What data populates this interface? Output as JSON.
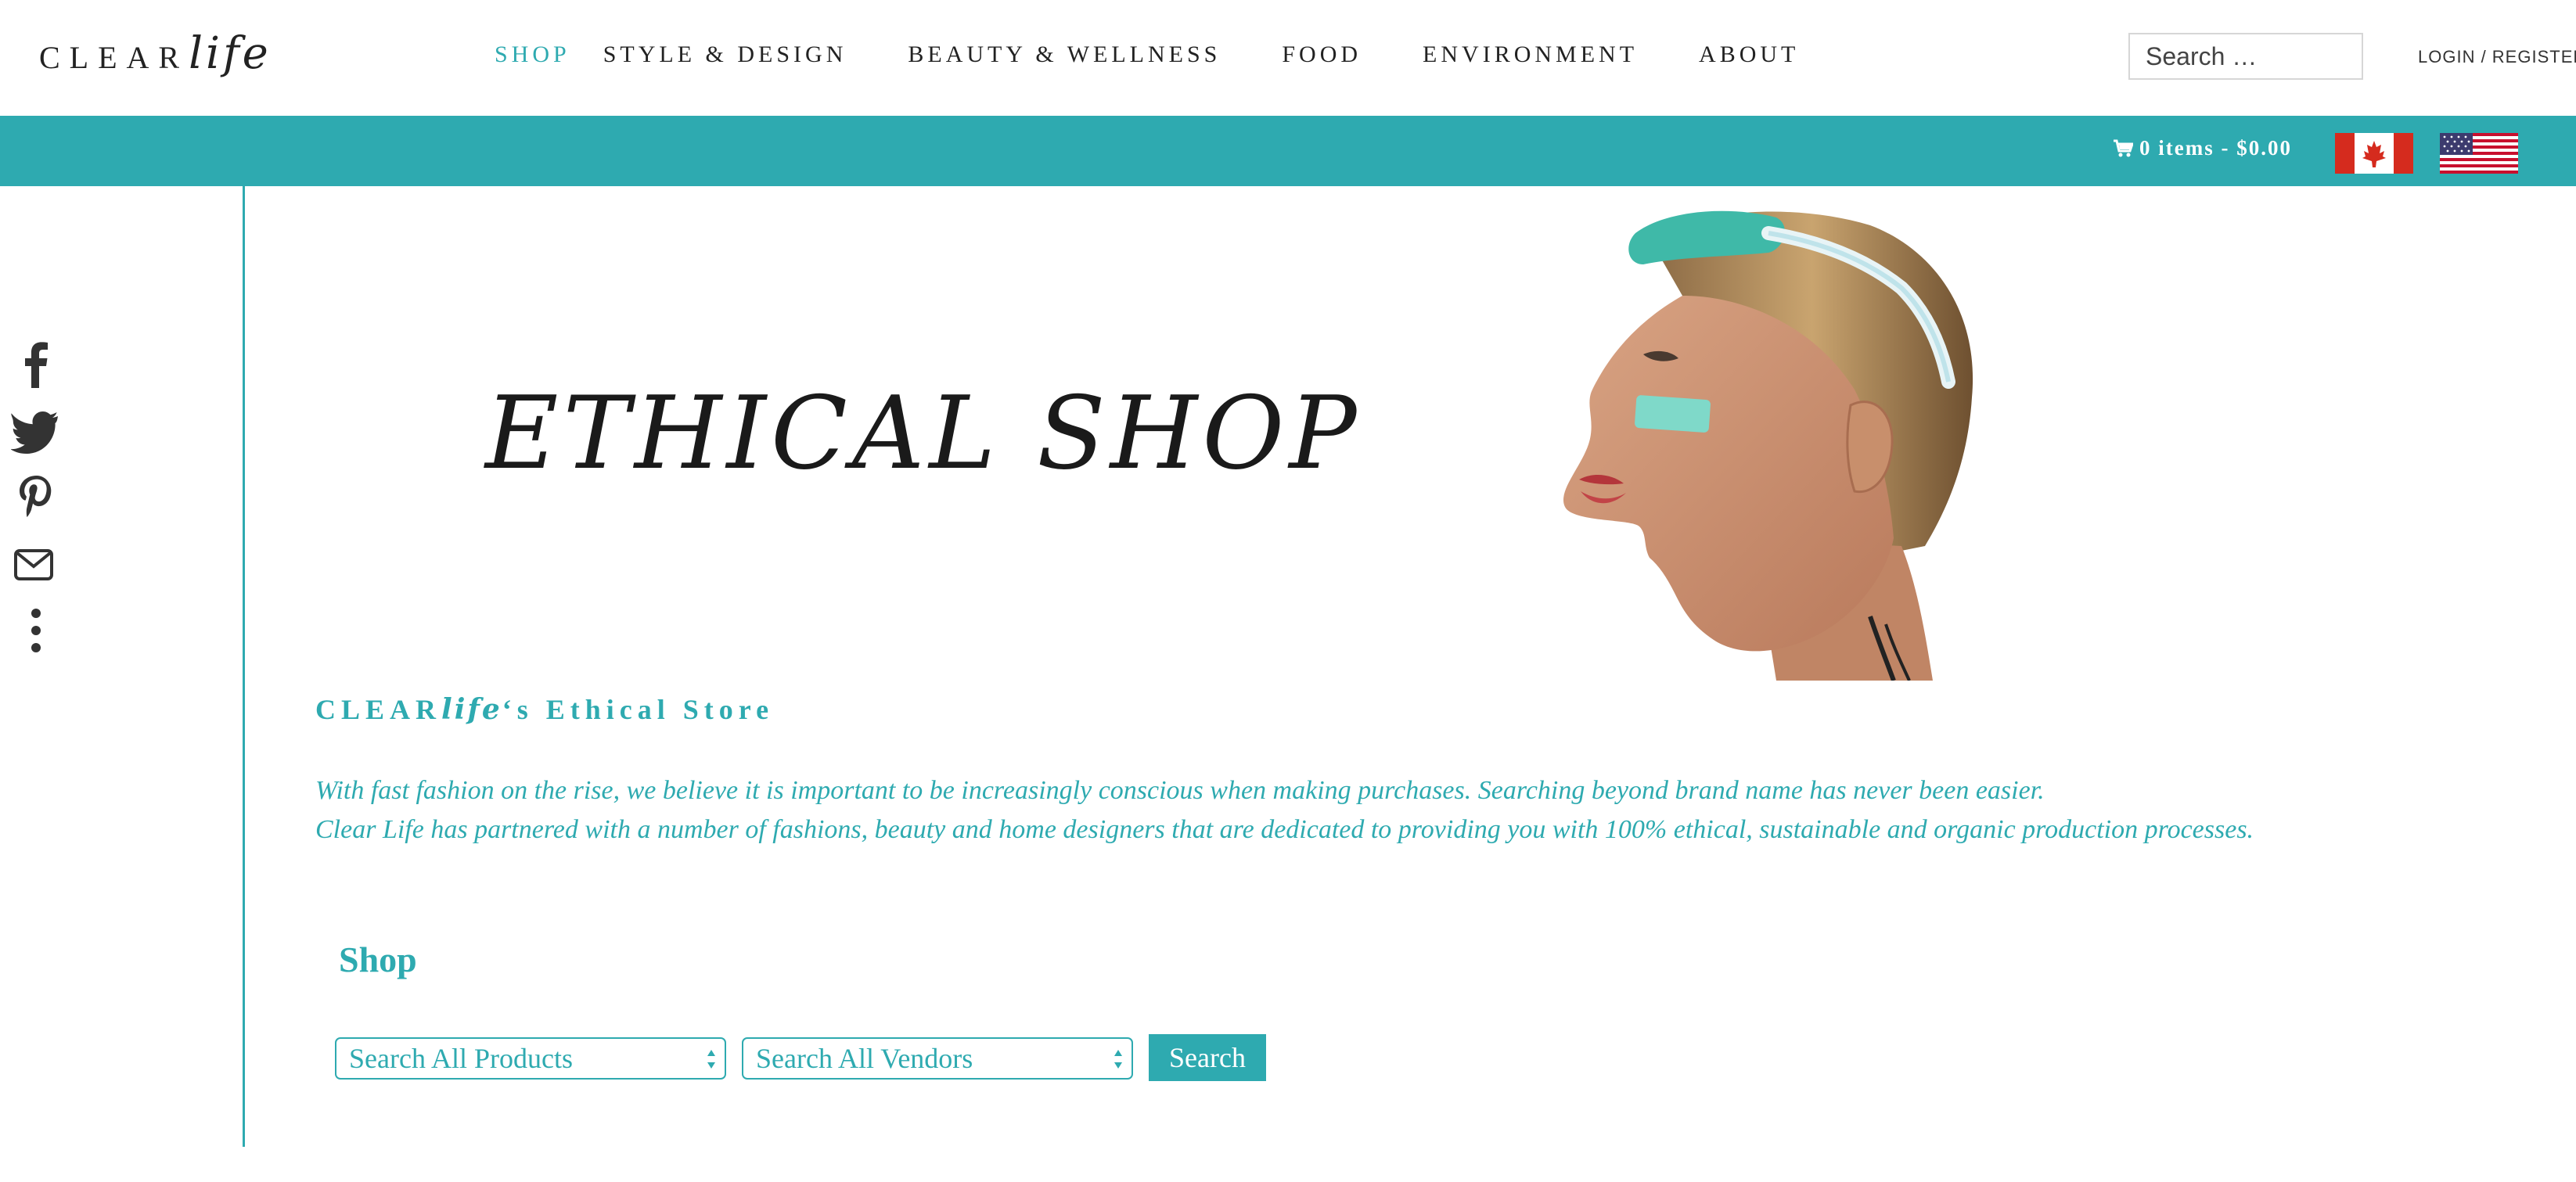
{
  "header": {
    "logo_caps": "CLEAR",
    "logo_script": "life",
    "nav": [
      {
        "label": "SHOP",
        "active": true
      },
      {
        "label": "STYLE & DESIGN",
        "active": false
      },
      {
        "label": "BEAUTY & WELLNESS",
        "active": false
      },
      {
        "label": "FOOD",
        "active": false
      },
      {
        "label": "ENVIRONMENT",
        "active": false
      },
      {
        "label": "ABOUT",
        "active": false
      }
    ],
    "search_placeholder": "Search …",
    "login_label": "LOGIN / REGISTER"
  },
  "top_bar": {
    "cart_label": "0 items - $0.00",
    "flags": [
      "canada-flag-icon",
      "usa-flag-icon"
    ]
  },
  "social": [
    "facebook-icon",
    "twitter-icon",
    "pinterest-icon",
    "email-icon",
    "more-icon"
  ],
  "hero": {
    "title": "ETHICAL SHOP"
  },
  "store": {
    "heading_prefix": "CLEAR",
    "heading_script": "life",
    "heading_suffix": "‘s Ethical Store",
    "intro_line1": "With fast fashion on the rise, we believe it is important to be increasingly conscious when making purchases. Searching beyond brand name has never been easier.",
    "intro_line2": "Clear Life has partnered with a number of fashions, beauty and home designers that are dedicated to providing you with 100% ethical, sustainable and organic production processes."
  },
  "shop": {
    "heading": "Shop",
    "products_select": "Search All Products",
    "vendors_select": "Search All Vendors",
    "search_button": "Search"
  },
  "colors": {
    "accent": "#2eaab0",
    "text": "#222222",
    "background": "#ffffff"
  }
}
